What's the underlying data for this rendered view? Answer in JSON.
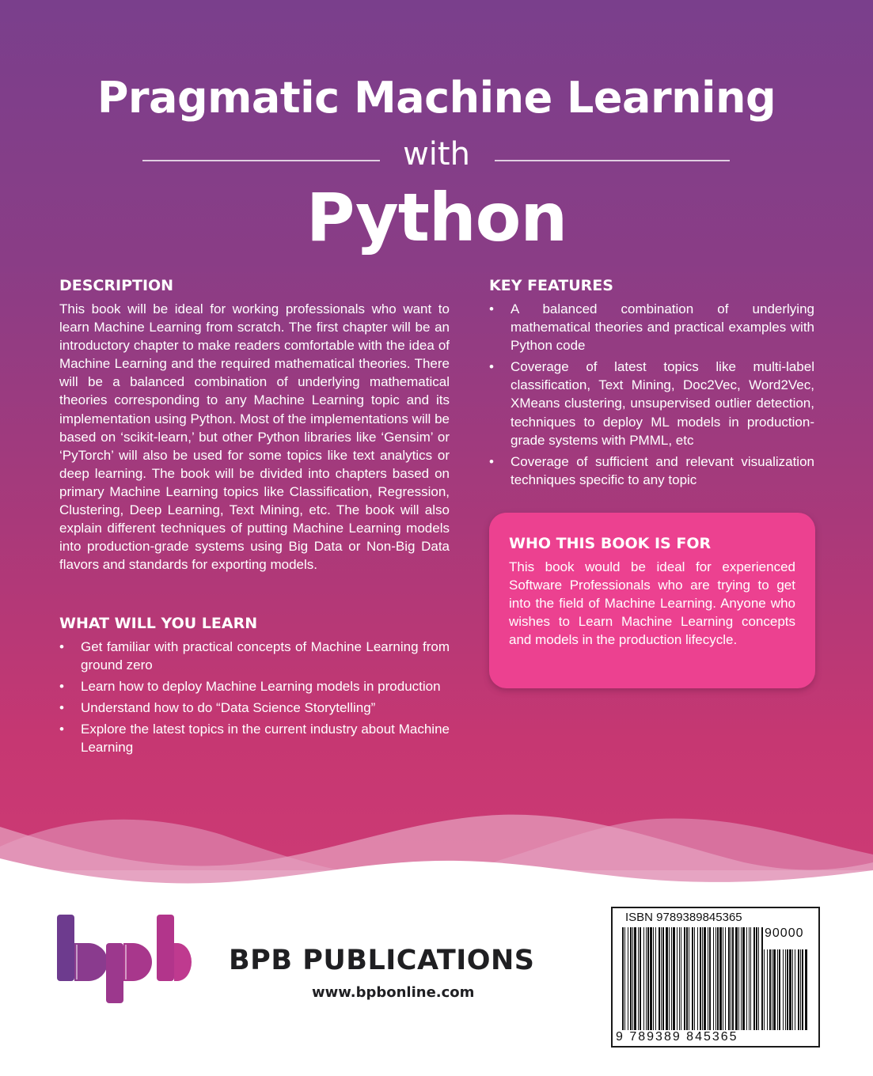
{
  "title": {
    "line1": "Pragmatic Machine Learning",
    "connector": "with",
    "line2": "Python"
  },
  "description": {
    "heading": "DESCRIPTION",
    "text": "This book will be ideal for working professionals who want to learn Machine Learning from scratch. The first chapter will be an introductory chapter to make readers comfortable with the idea of Machine Learning and the required mathematical theories. There will be a balanced combination of underlying mathematical theories corresponding to any Machine Learning topic and its implementation using Python. Most of the implementations will be based on ‘scikit-learn,’ but other Python libraries like ‘Gensim’ or ‘PyTorch’ will also be used for some topics like text analytics or deep learning. The book will be divided into chapters based on primary Machine Learning topics like Classification, Regression, Clustering, Deep Learning, Text Mining, etc. The book will also explain different techniques of putting Machine Learning models into production-grade systems using Big Data or Non-Big Data flavors and standards for exporting models."
  },
  "learn": {
    "heading": "WHAT WILL YOU LEARN",
    "items": [
      "Get familiar with practical concepts of Machine Learning from ground zero",
      "Learn how to deploy Machine Learning models in production",
      "Understand how to do “Data Science Storytelling”",
      "Explore the latest topics in the current industry about Machine Learning"
    ]
  },
  "features": {
    "heading": "KEY FEATURES",
    "items": [
      "A balanced combination of underlying mathematical theories and practical examples with Python code",
      "Coverage of latest topics like multi-label classification, Text Mining, Doc2Vec, Word2Vec, XMeans clustering, unsupervised outlier detection, techniques to deploy ML models in production-grade systems with PMML, etc",
      "Coverage of sufficient and relevant visualization techniques specific to any topic"
    ]
  },
  "audience": {
    "heading": "WHO THIS BOOK IS FOR",
    "text": "This book would be ideal for experienced Software Professionals who are trying to get into the field of Machine Learning. Anyone who wishes to Learn Machine Learning concepts and models in the production lifecycle."
  },
  "publisher": {
    "name": "BPB PUBLICATIONS",
    "url": "www.bpbonline.com",
    "logo_text": "bpb"
  },
  "barcode": {
    "isbn_label": "ISBN 9789389845365",
    "price_code": "90000",
    "digits": "9 789389 845365"
  },
  "bullet_symbol": "•",
  "colors": {
    "gradient_top": "#7a3f8c",
    "gradient_bottom": "#cc3a74",
    "callout_pink": "#ec4190",
    "logo_purple": "#6d3b8e",
    "logo_magenta": "#b2358b",
    "text_dark": "#1f1f22"
  }
}
